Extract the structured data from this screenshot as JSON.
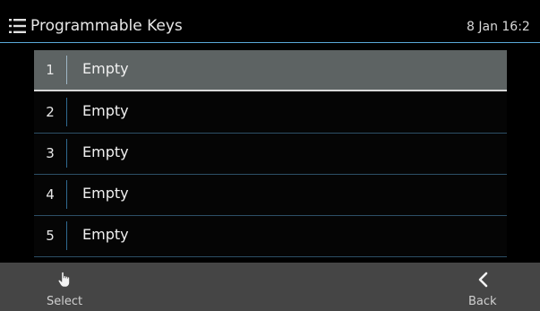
{
  "header": {
    "title": "Programmable Keys",
    "datetime": "8 Jan 16:2",
    "menu_icon": "list-menu-icon",
    "accent_color": "#5aa9d8"
  },
  "list": {
    "selected_index": 0,
    "items": [
      {
        "number": "1",
        "label": "Empty"
      },
      {
        "number": "2",
        "label": "Empty"
      },
      {
        "number": "3",
        "label": "Empty"
      },
      {
        "number": "4",
        "label": "Empty"
      },
      {
        "number": "5",
        "label": "Empty"
      }
    ]
  },
  "softkeys": {
    "left": {
      "label": "Select",
      "icon": "tap-hand-icon"
    },
    "right": {
      "label": "Back",
      "icon": "chevron-left-icon"
    }
  }
}
